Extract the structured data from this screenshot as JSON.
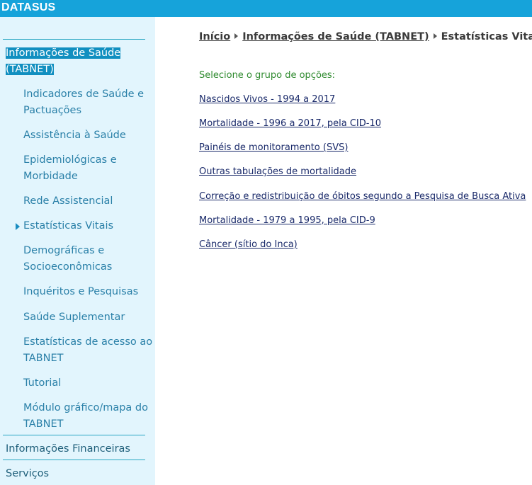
{
  "header": {
    "brand": "DATASUS"
  },
  "sidebar": {
    "top_active_line1": "Informações de Saúde",
    "top_active_line2": "(TABNET)",
    "items": [
      {
        "line1": "Indicadores de Saúde e",
        "line2": "Pactuações"
      },
      {
        "line1": "Assistência à Saúde"
      },
      {
        "line1": "Epidemiológicas e",
        "line2": "Morbidade"
      },
      {
        "line1": "Rede Assistencial"
      },
      {
        "line1": "Estatísticas Vitais"
      },
      {
        "line1": "Demográficas e",
        "line2": "Socioeconômicas"
      },
      {
        "line1": "Inquéritos e Pesquisas"
      },
      {
        "line1": "Saúde Suplementar"
      },
      {
        "line1": "Estatísticas de acesso ao",
        "line2": "TABNET"
      },
      {
        "line1": "Tutorial"
      },
      {
        "line1": "Módulo gráfico/mapa do",
        "line2": "TABNET"
      }
    ],
    "financeiras": "Informações Financeiras",
    "servicos": "Serviços"
  },
  "breadcrumb": {
    "home": "Início",
    "section": "Informações de Saúde (TABNET)",
    "current": "Estatísticas Vitais"
  },
  "main": {
    "prompt": "Selecione o grupo de opções:",
    "links": [
      "Nascidos Vivos - 1994 a 2017",
      "Mortalidade - 1996 a 2017, pela CID-10",
      "Painéis de monitoramento (SVS)",
      "Outras tabulações de mortalidade",
      "Correção e redistribuição de óbitos segundo a Pesquisa de Busca Ativa",
      "Mortalidade - 1979 a 1995, pela CID-9",
      "Câncer (sítio do Inca)"
    ]
  },
  "colors": {
    "topbar": "#16a3da",
    "sidebar_bg": "#e2f5fd",
    "active_highlight": "#118fc0",
    "link": "#1a2a6a",
    "prompt": "#2e8a2e"
  }
}
